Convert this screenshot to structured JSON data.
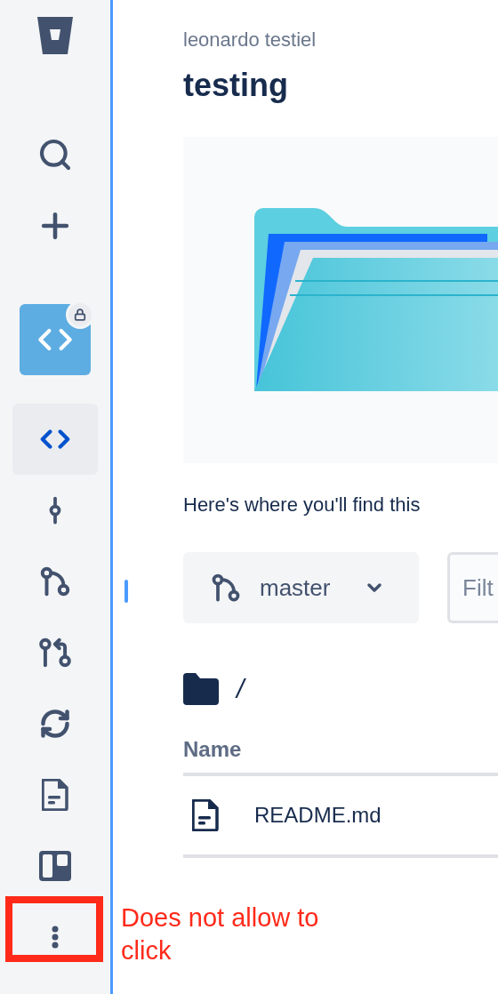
{
  "sidebar": {
    "repository": {
      "private": true
    },
    "nav_items": [
      {
        "kind": "source",
        "selected": true
      },
      {
        "kind": "commits",
        "selected": false
      },
      {
        "kind": "branches",
        "selected": false
      },
      {
        "kind": "pull_requests",
        "selected": false
      },
      {
        "kind": "pipelines",
        "selected": false
      },
      {
        "kind": "wiki",
        "selected": false
      },
      {
        "kind": "board",
        "selected": false
      },
      {
        "kind": "more",
        "selected": false
      }
    ]
  },
  "header": {
    "owner": "leonardo testiel",
    "title": "testing"
  },
  "description": "Here's where you'll find this",
  "branch_selector": {
    "value": "master"
  },
  "filter": {
    "placeholder": "Filt"
  },
  "path": "/",
  "table": {
    "columns": [
      "Name"
    ],
    "rows": [
      {
        "name": "README.md"
      }
    ]
  },
  "annotation": {
    "text": "Does not allow to click"
  }
}
